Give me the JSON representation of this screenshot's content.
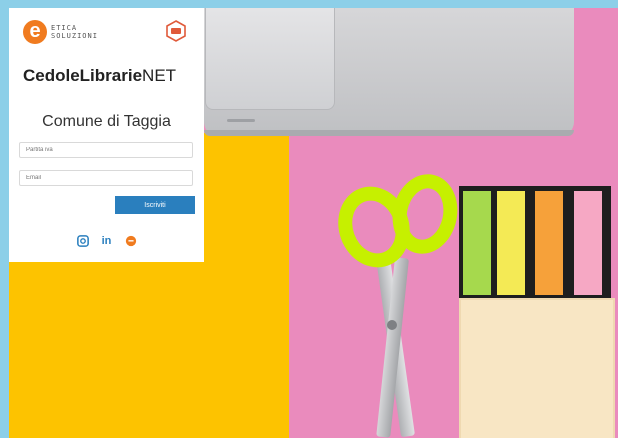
{
  "brand": {
    "logo_line1": "ETICA",
    "logo_line2": "SOLUZIONI",
    "app_name_bold": "CedoleLibrarie",
    "app_name_regular": "NET"
  },
  "panel": {
    "municipality": "Comune di Taggia",
    "vat_placeholder": "Partita iva",
    "email_placeholder": "Email",
    "submit_label": "Iscriviti"
  },
  "socials": [
    {
      "icon": "instagram-icon"
    },
    {
      "icon": "linkedin-icon",
      "label": "in"
    },
    {
      "icon": "etica-icon"
    }
  ],
  "colors": {
    "accent_blue": "#2a7fbe",
    "brand_orange": "#f07b1f"
  }
}
